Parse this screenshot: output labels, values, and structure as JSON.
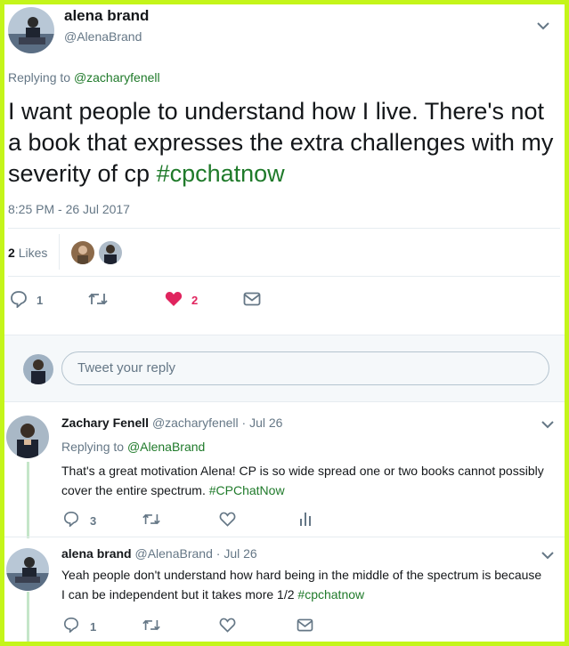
{
  "main_tweet": {
    "display_name": "alena brand",
    "handle": "@AlenaBrand",
    "replying_prefix": "Replying to",
    "replying_handle": "@zacharyfenell",
    "text_part1": "I want people to understand how I live. There's not a book that expresses the extra challenges with my severity of cp",
    "hashtag": "#cpchatnow",
    "timestamp": "8:25 PM - 26 Jul 2017",
    "likes_count": "2",
    "likes_label": "Likes",
    "reply_count": "1",
    "like_action_count": "2"
  },
  "reply_box": {
    "placeholder": "Tweet your reply"
  },
  "replies": [
    {
      "display_name": "Zachary Fenell",
      "handle": "@zacharyfenell",
      "time": "· Jul 26",
      "replying_prefix": "Replying to",
      "replying_handle": "@AlenaBrand",
      "text": "That's a great motivation Alena! CP is so wide spread one or two books cannot possibly cover the entire spectrum.",
      "hashtag": "#CPChatNow",
      "reply_count": "3"
    },
    {
      "display_name": "alena brand",
      "handle": "@AlenaBrand",
      "time": "· Jul 26",
      "text": "Yeah people don't understand how hard being in the middle of the spectrum is because I can be independent but it takes more 1/2",
      "hashtag": "#cpchatnow",
      "reply_count": "1"
    }
  ],
  "colors": {
    "border": "#c4f51a",
    "hashtag": "#1f7a2a",
    "heart": "#e0245e",
    "muted": "#657786"
  }
}
